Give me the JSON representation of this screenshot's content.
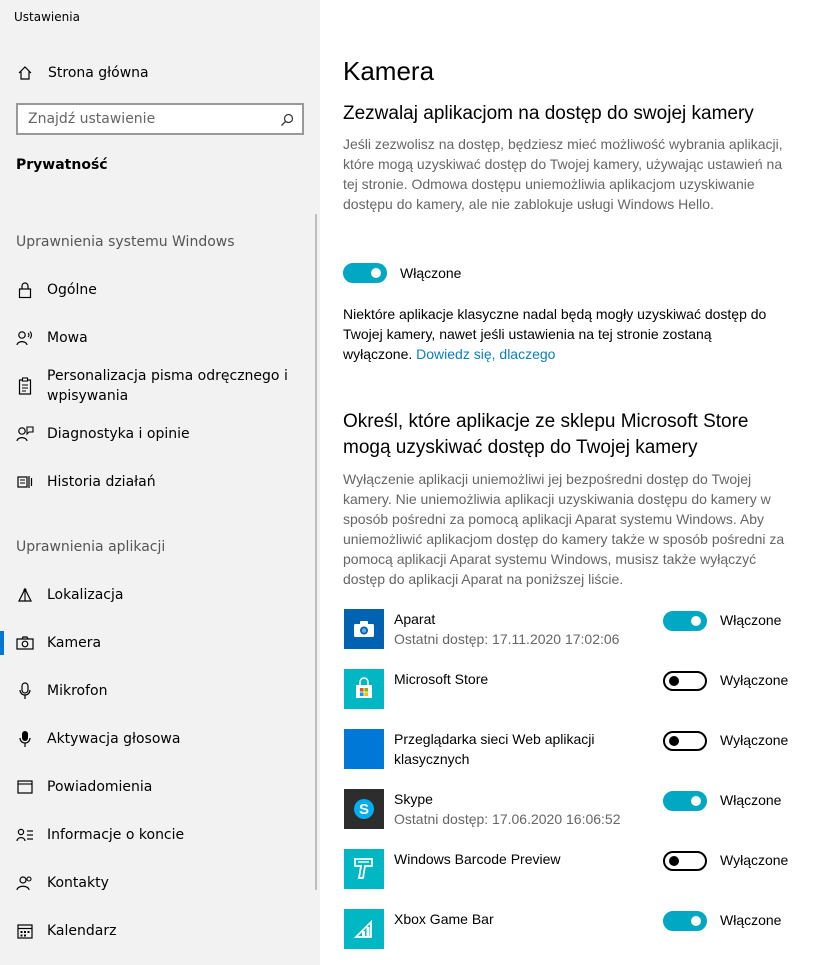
{
  "window": {
    "title": "Ustawienia"
  },
  "sidebar": {
    "home_label": "Strona główna",
    "search_placeholder": "Znajdź ustawienie",
    "section_title": "Prywatność",
    "group_windows": "Uprawnienia systemu Windows",
    "group_apps": "Uprawnienia aplikacji",
    "windows_items": [
      {
        "label": "Ogólne",
        "icon": "lock-icon"
      },
      {
        "label": "Mowa",
        "icon": "speech-icon"
      },
      {
        "label": "Personalizacja pisma odręcznego i wpisywania",
        "icon": "clipboard-icon"
      },
      {
        "label": "Diagnostyka i opinie",
        "icon": "feedback-icon"
      },
      {
        "label": "Historia działań",
        "icon": "timeline-icon"
      }
    ],
    "app_items": [
      {
        "label": "Lokalizacja",
        "icon": "location-icon"
      },
      {
        "label": "Kamera",
        "icon": "camera-icon",
        "active": true
      },
      {
        "label": "Mikrofon",
        "icon": "microphone-icon"
      },
      {
        "label": "Aktywacja głosowa",
        "icon": "voice-activation-icon"
      },
      {
        "label": "Powiadomienia",
        "icon": "notifications-icon"
      },
      {
        "label": "Informacje o koncie",
        "icon": "account-info-icon"
      },
      {
        "label": "Kontakty",
        "icon": "contacts-icon"
      },
      {
        "label": "Kalendarz",
        "icon": "calendar-icon"
      }
    ],
    "accent_color": "#0078d4"
  },
  "main": {
    "title": "Kamera",
    "section1": {
      "heading": "Zezwalaj aplikacjom na dostęp do swojej kamery",
      "description": "Jeśli zezwolisz na dostęp, będziesz mieć możliwość wybrania aplikacji, które mogą uzyskiwać dostęp do Twojej kamery, używając ustawień na tej stronie. Odmowa dostępu uniemożliwia aplikacjom uzyskiwanie dostępu do kamery, ale nie zablokuje usługi Windows Hello.",
      "toggle_state": "on",
      "toggle_label": "Włączone",
      "note": "Niektóre aplikacje klasyczne nadal będą mogły uzyskiwać dostęp do Twojej kamery, nawet jeśli ustawienia na tej stronie zostaną wyłączone.",
      "note_link": "Dowiedz się, dlaczego"
    },
    "section2": {
      "heading": "Określ, które aplikacje ze sklepu Microsoft Store mogą uzyskiwać dostęp do Twojej kamery",
      "description": "Wyłączenie aplikacji uniemożliwi jej bezpośredni dostęp do Twojej kamery. Nie uniemożliwia aplikacji uzyskiwania dostępu do kamery w sposób pośredni za pomocą aplikacji Aparat systemu Windows. Aby uniemożliwić aplikacjom dostęp do kamery także w sposób pośredni za pomocą aplikacji Aparat systemu Windows, musisz także wyłączyć dostęp do aplikacji Aparat na poniższej liście."
    },
    "apps": [
      {
        "name": "Aparat",
        "sub": "Ostatni dostęp: 17.11.2020 17:02:06",
        "state": "on",
        "state_label": "Włączone",
        "icon": "camera-app-icon",
        "color": "#0063b1"
      },
      {
        "name": "Microsoft Store",
        "sub": "",
        "state": "off",
        "state_label": "Wyłączone",
        "icon": "store-icon",
        "color": "#00b7c3"
      },
      {
        "name": "Przeglądarka sieci Web aplikacji klasycznych",
        "sub": "",
        "state": "off",
        "state_label": "Wyłączone",
        "icon": "web-viewer-icon",
        "color": "#0078d7"
      },
      {
        "name": "Skype",
        "sub": "Ostatni dostęp: 17.06.2020 16:06:52",
        "state": "on",
        "state_label": "Włączone",
        "icon": "skype-icon",
        "color": "#2d2d2d"
      },
      {
        "name": "Windows Barcode Preview",
        "sub": "",
        "state": "off",
        "state_label": "Wyłączone",
        "icon": "barcode-scanner-icon",
        "color": "#00b7c3"
      },
      {
        "name": "Xbox Game Bar",
        "sub": "",
        "state": "on",
        "state_label": "Włączone",
        "icon": "game-bar-icon",
        "color": "#00b7c3"
      }
    ],
    "toggle_on_color": "#00a8c4",
    "link_color": "#0a7ec2"
  }
}
